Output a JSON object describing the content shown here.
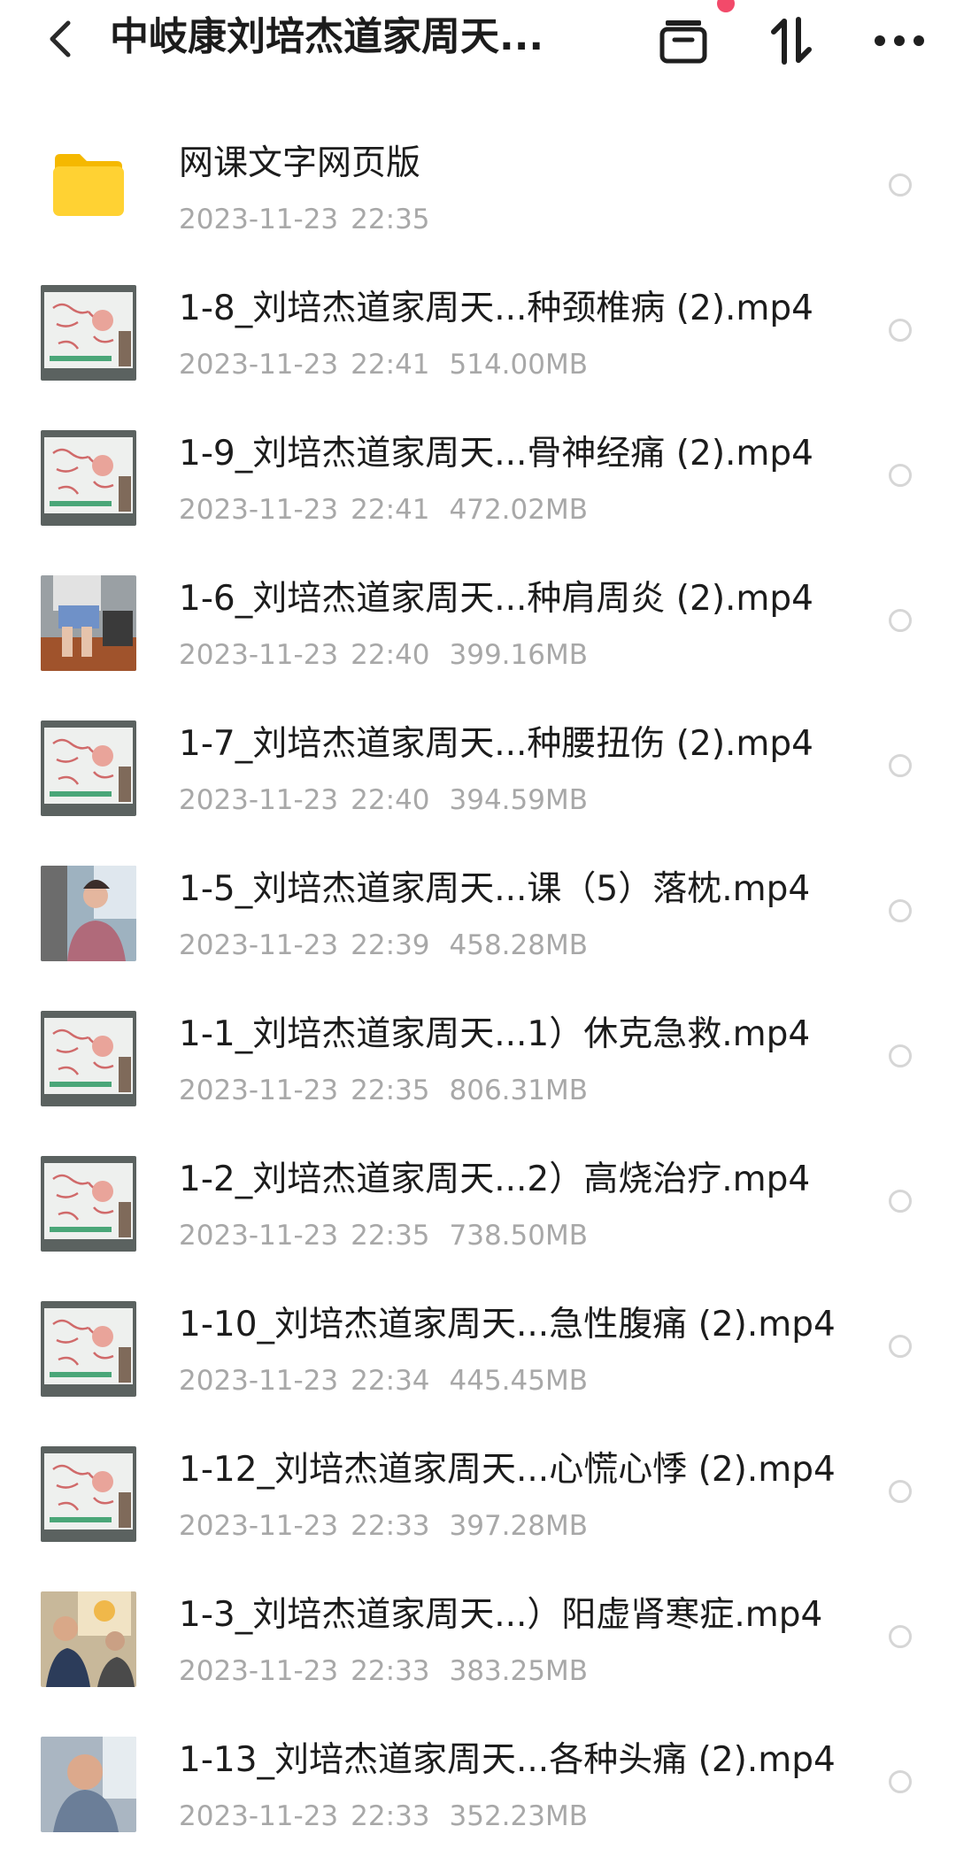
{
  "header": {
    "title": "中岐康刘培杰道家周天...",
    "icons": {
      "back": "chevron-left-icon",
      "archive": "archive-icon",
      "sort": "sort-icon",
      "more": "more-horizontal-icon"
    },
    "notification_color": "#f24a6a"
  },
  "files": [
    {
      "kind": "folder",
      "name": "网课文字网页版",
      "date": "2023-11-23",
      "time": "22:35",
      "size": ""
    },
    {
      "kind": "video",
      "thumb": "whiteboard",
      "name": "1-8_刘培杰道家周天...种颈椎病 (2).mp4",
      "date": "2023-11-23",
      "time": "22:41",
      "size": "514.00MB"
    },
    {
      "kind": "video",
      "thumb": "whiteboard",
      "name": "1-9_刘培杰道家周天...骨神经痛 (2).mp4",
      "date": "2023-11-23",
      "time": "22:41",
      "size": "472.02MB"
    },
    {
      "kind": "video",
      "thumb": "legs",
      "name": "1-6_刘培杰道家周天...种肩周炎 (2).mp4",
      "date": "2023-11-23",
      "time": "22:40",
      "size": "399.16MB"
    },
    {
      "kind": "video",
      "thumb": "whiteboard",
      "name": "1-7_刘培杰道家周天...种腰扭伤 (2).mp4",
      "date": "2023-11-23",
      "time": "22:40",
      "size": "394.59MB"
    },
    {
      "kind": "video",
      "thumb": "person",
      "name": "1-5_刘培杰道家周天...课（5）落枕.mp4",
      "date": "2023-11-23",
      "time": "22:39",
      "size": "458.28MB"
    },
    {
      "kind": "video",
      "thumb": "whiteboard",
      "name": "1-1_刘培杰道家周天...1）休克急救.mp4",
      "date": "2023-11-23",
      "time": "22:35",
      "size": "806.31MB"
    },
    {
      "kind": "video",
      "thumb": "whiteboard",
      "name": "1-2_刘培杰道家周天...2）高烧治疗.mp4",
      "date": "2023-11-23",
      "time": "22:35",
      "size": "738.50MB"
    },
    {
      "kind": "video",
      "thumb": "whiteboard",
      "name": "1-10_刘培杰道家周天...急性腹痛 (2).mp4",
      "date": "2023-11-23",
      "time": "22:34",
      "size": "445.45MB"
    },
    {
      "kind": "video",
      "thumb": "whiteboard",
      "name": "1-12_刘培杰道家周天...心慌心悸 (2).mp4",
      "date": "2023-11-23",
      "time": "22:33",
      "size": "397.28MB"
    },
    {
      "kind": "video",
      "thumb": "people",
      "name": "1-3_刘培杰道家周天...）阳虚肾寒症.mp4",
      "date": "2023-11-23",
      "time": "22:33",
      "size": "383.25MB"
    },
    {
      "kind": "video",
      "thumb": "person2",
      "name": "1-13_刘培杰道家周天...各种头痛 (2).mp4",
      "date": "2023-11-23",
      "time": "22:33",
      "size": "352.23MB"
    }
  ]
}
